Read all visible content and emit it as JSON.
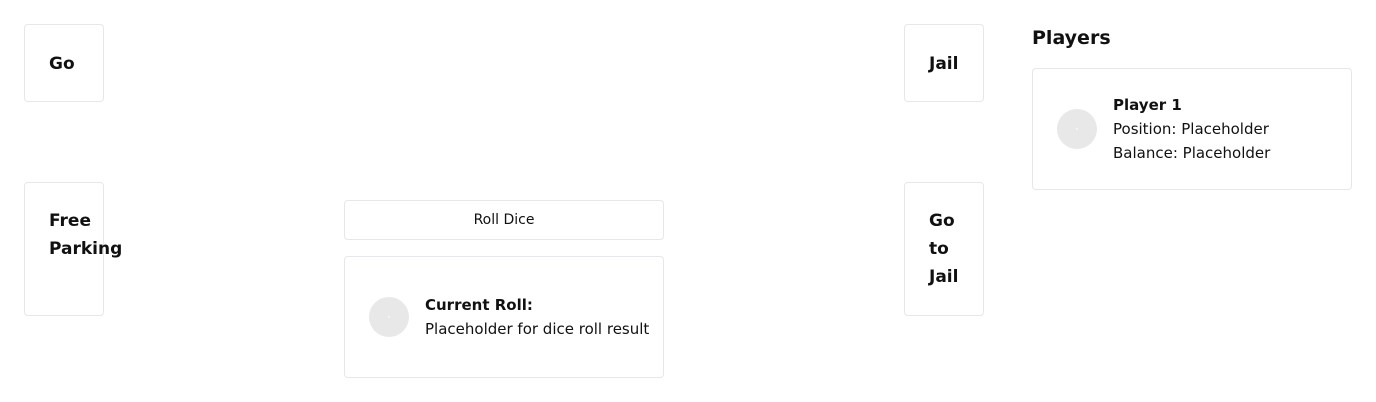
{
  "board": {
    "spaces": {
      "go": "Go",
      "jail": "Jail",
      "free_parking": "Free Parking",
      "go_to_jail": "Go to Jail"
    }
  },
  "controls": {
    "roll_button": "Roll Dice"
  },
  "roll": {
    "title": "Current Roll:",
    "result": "Placeholder for dice roll result",
    "avatar_icon": "dice-avatar-icon"
  },
  "players": {
    "heading": "Players",
    "list": [
      {
        "name": "Player 1",
        "position": "Position: Placeholder",
        "balance": "Balance: Placeholder",
        "avatar_icon": "player-avatar-icon"
      }
    ]
  },
  "colors": {
    "border": "#e5e7eb",
    "avatar": "#e8e8e8",
    "text": "#111111"
  }
}
